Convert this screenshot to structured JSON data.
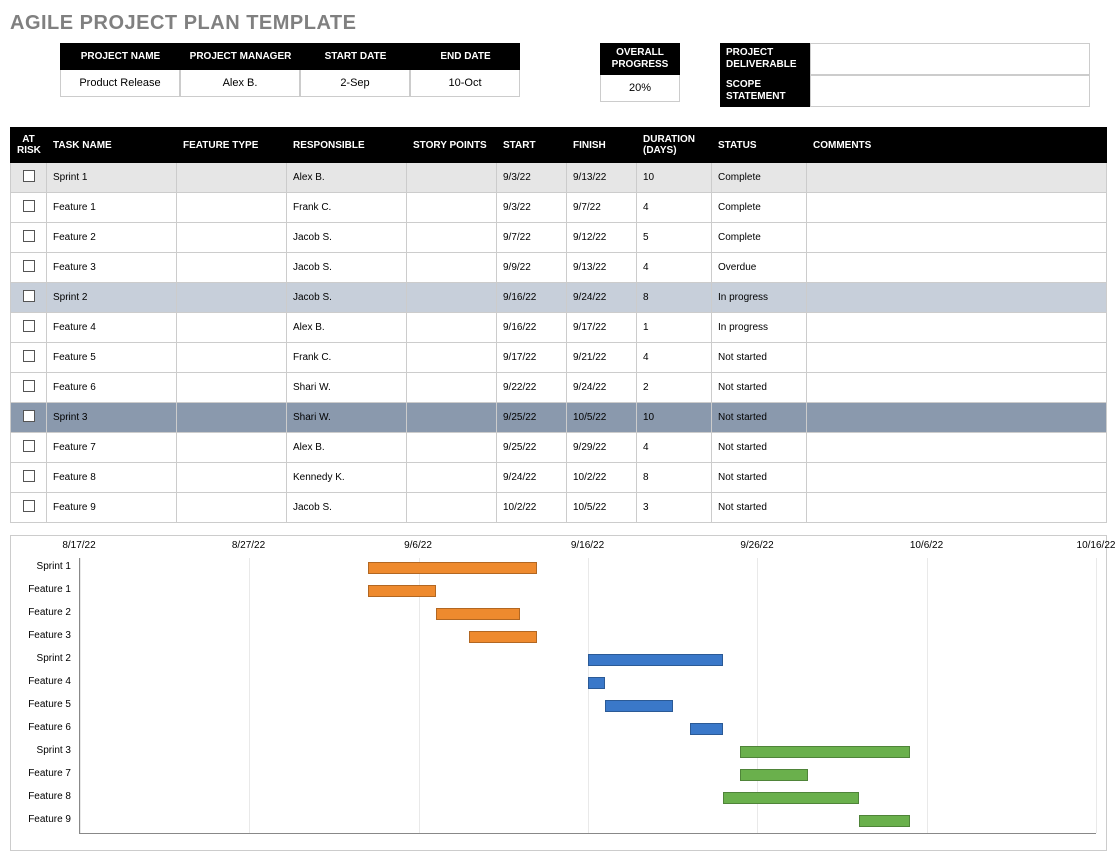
{
  "title": "AGILE PROJECT PLAN TEMPLATE",
  "info": {
    "headers": {
      "project_name": "PROJECT NAME",
      "project_manager": "PROJECT MANAGER",
      "start_date": "START DATE",
      "end_date": "END DATE"
    },
    "values": {
      "project_name": "Product Release",
      "project_manager": "Alex B.",
      "start_date": "2-Sep",
      "end_date": "10-Oct"
    },
    "overall_progress": {
      "label": "OVERALL PROGRESS",
      "value": "20%"
    },
    "deliverable_label": "PROJECT DELIVERABLE",
    "scope_label": "SCOPE STATEMENT"
  },
  "columns": {
    "at_risk": "AT RISK",
    "task_name": "TASK NAME",
    "feature_type": "FEATURE TYPE",
    "responsible": "RESPONSIBLE",
    "story_points": "STORY POINTS",
    "start": "START",
    "finish": "FINISH",
    "duration": "DURATION (DAYS)",
    "status": "STATUS",
    "comments": "COMMENTS"
  },
  "rows": [
    {
      "sprint": 0,
      "header": true,
      "name": "Sprint 1",
      "responsible": "Alex B.",
      "start": "9/3/22",
      "finish": "9/13/22",
      "duration": "10",
      "status": "Complete"
    },
    {
      "sprint": 0,
      "name": "Feature 1",
      "responsible": "Frank C.",
      "start": "9/3/22",
      "finish": "9/7/22",
      "duration": "4",
      "status": "Complete"
    },
    {
      "sprint": 0,
      "name": "Feature 2",
      "responsible": "Jacob S.",
      "start": "9/7/22",
      "finish": "9/12/22",
      "duration": "5",
      "status": "Complete"
    },
    {
      "sprint": 0,
      "name": "Feature 3",
      "responsible": "Jacob S.",
      "start": "9/9/22",
      "finish": "9/13/22",
      "duration": "4",
      "status": "Overdue"
    },
    {
      "sprint": 1,
      "header": true,
      "name": "Sprint 2",
      "responsible": "Jacob S.",
      "start": "9/16/22",
      "finish": "9/24/22",
      "duration": "8",
      "status": "In progress"
    },
    {
      "sprint": 1,
      "name": "Feature 4",
      "responsible": "Alex B.",
      "start": "9/16/22",
      "finish": "9/17/22",
      "duration": "1",
      "status": "In progress"
    },
    {
      "sprint": 1,
      "name": "Feature 5",
      "responsible": "Frank C.",
      "start": "9/17/22",
      "finish": "9/21/22",
      "duration": "4",
      "status": "Not started"
    },
    {
      "sprint": 1,
      "name": "Feature 6",
      "responsible": "Shari W.",
      "start": "9/22/22",
      "finish": "9/24/22",
      "duration": "2",
      "status": "Not started"
    },
    {
      "sprint": 2,
      "header": true,
      "name": "Sprint 3",
      "responsible": "Shari W.",
      "start": "9/25/22",
      "finish": "10/5/22",
      "duration": "10",
      "status": "Not started"
    },
    {
      "sprint": 2,
      "name": "Feature 7",
      "responsible": "Alex B.",
      "start": "9/25/22",
      "finish": "9/29/22",
      "duration": "4",
      "status": "Not started"
    },
    {
      "sprint": 2,
      "name": "Feature 8",
      "responsible": "Kennedy K.",
      "start": "9/24/22",
      "finish": "10/2/22",
      "duration": "8",
      "status": "Not started"
    },
    {
      "sprint": 2,
      "name": "Feature 9",
      "responsible": "Jacob S.",
      "start": "10/2/22",
      "finish": "10/5/22",
      "duration": "3",
      "status": "Not started"
    }
  ],
  "chart_data": {
    "type": "bar",
    "orientation": "horizontal-gantt",
    "x_axis_dates": [
      "8/17/22",
      "8/27/22",
      "9/6/22",
      "9/16/22",
      "9/26/22",
      "10/6/22",
      "10/16/22"
    ],
    "x_range_days": [
      0,
      60
    ],
    "origin": "2022-08-17",
    "series": [
      {
        "name": "Sprint 1",
        "group": 0,
        "start": "9/3/22",
        "finish": "9/13/22",
        "start_day": 17,
        "duration": 10
      },
      {
        "name": "Feature 1",
        "group": 0,
        "start": "9/3/22",
        "finish": "9/7/22",
        "start_day": 17,
        "duration": 4
      },
      {
        "name": "Feature 2",
        "group": 0,
        "start": "9/7/22",
        "finish": "9/12/22",
        "start_day": 21,
        "duration": 5
      },
      {
        "name": "Feature 3",
        "group": 0,
        "start": "9/9/22",
        "finish": "9/13/22",
        "start_day": 23,
        "duration": 4
      },
      {
        "name": "Sprint 2",
        "group": 1,
        "start": "9/16/22",
        "finish": "9/24/22",
        "start_day": 30,
        "duration": 8
      },
      {
        "name": "Feature 4",
        "group": 1,
        "start": "9/16/22",
        "finish": "9/17/22",
        "start_day": 30,
        "duration": 1
      },
      {
        "name": "Feature 5",
        "group": 1,
        "start": "9/17/22",
        "finish": "9/21/22",
        "start_day": 31,
        "duration": 4
      },
      {
        "name": "Feature 6",
        "group": 1,
        "start": "9/22/22",
        "finish": "9/24/22",
        "start_day": 36,
        "duration": 2
      },
      {
        "name": "Sprint 3",
        "group": 2,
        "start": "9/25/22",
        "finish": "10/5/22",
        "start_day": 39,
        "duration": 10
      },
      {
        "name": "Feature 7",
        "group": 2,
        "start": "9/25/22",
        "finish": "9/29/22",
        "start_day": 39,
        "duration": 4
      },
      {
        "name": "Feature 8",
        "group": 2,
        "start": "9/24/22",
        "finish": "10/2/22",
        "start_day": 38,
        "duration": 8
      },
      {
        "name": "Feature 9",
        "group": 2,
        "start": "10/2/22",
        "finish": "10/5/22",
        "start_day": 46,
        "duration": 3
      }
    ],
    "colors": {
      "0": "#ee8a2e",
      "1": "#3a78c9",
      "2": "#6ab04c"
    }
  }
}
